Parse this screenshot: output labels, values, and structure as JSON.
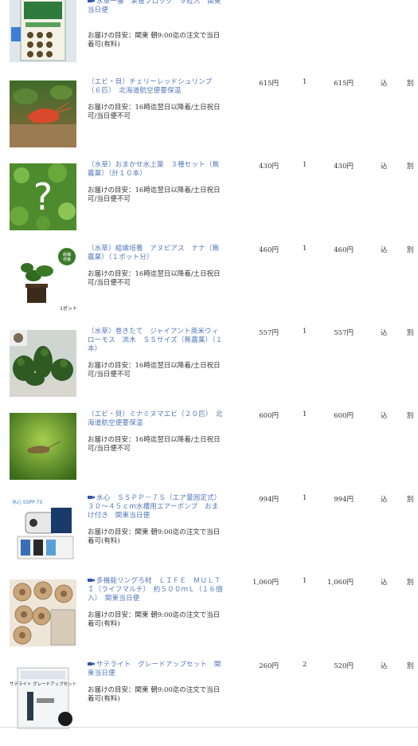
{
  "cart": {
    "items": [
      {
        "title": "水草一番　栄養ブロック　９粒入　関東当日便",
        "delivery": "お届けの目安：関東 朝9:00迄の注文で当日着可(有料)",
        "price": "",
        "qty": "",
        "subtotal": "",
        "tax": "",
        "shipping": "",
        "shop_icon": true,
        "image": "nutrition-block-package"
      },
      {
        "title": "（エビ・貝）チェリーレッドシュリンプ（６匹）　北海道航空便要保温",
        "delivery": "お届けの目安：16時迄翌日以降着/土日祝日可/当日便不可",
        "price": "615円",
        "qty": "1",
        "subtotal": "615円",
        "tax": "込",
        "shipping": "別",
        "shop_icon": false,
        "image": "cherry-shrimp"
      },
      {
        "title": "（水草）おまかせ水上葉　３種セット（無農薬）（計１０本）",
        "delivery": "お届けの目安：16時迄翌日以降着/土日祝日可/当日便不可",
        "price": "430円",
        "qty": "1",
        "subtotal": "430円",
        "tax": "込",
        "shipping": "別",
        "shop_icon": false,
        "image": "mystery-plants",
        "image_glyph": "?"
      },
      {
        "title": "（水草）組織培養　アヌビアス　ナナ（無農薬）（１ポット分）",
        "delivery": "お届けの目安：16時迄翌日以降着/土日祝日可/当日便不可",
        "price": "460円",
        "qty": "1",
        "subtotal": "460円",
        "tax": "込",
        "shipping": "別",
        "shop_icon": false,
        "image": "anubias-pot",
        "image_badge": "組織培養",
        "image_caption": "1ポット"
      },
      {
        "title": "（水草）巻きたて　ジャイアント南米ウィローモス　流木　ＳＳサイズ（無農薬）（１本）",
        "delivery": "お届けの目安：16時迄翌日以降着/土日祝日可/当日便不可",
        "price": "557円",
        "qty": "1",
        "subtotal": "557円",
        "tax": "込",
        "shipping": "別",
        "shop_icon": false,
        "image": "willow-moss-driftwood"
      },
      {
        "title": "（エビ・貝）ミナミヌマエビ（２０匹）　北海道航空便要保温",
        "delivery": "お届けの目安：16時迄翌日以降着/土日祝日可/当日便不可",
        "price": "600円",
        "qty": "1",
        "subtotal": "600円",
        "tax": "込",
        "shipping": "別",
        "shop_icon": false,
        "image": "minami-shrimp"
      },
      {
        "title": "水心　ＳＳＰＰ－７Ｓ（エア量固定式）　３０～４５ｃｍ水槽用エアーポンプ　おまけ付き　関東当日便",
        "delivery": "お届けの目安：関東 朝9:00迄の注文で当日着可(有料)",
        "price": "994円",
        "qty": "1",
        "subtotal": "994円",
        "tax": "込",
        "shipping": "別",
        "shop_icon": true,
        "image": "air-pump"
      },
      {
        "title": "多機能リングろ材　ＬＩＦＥ　ＭＵＬＴＩ（ライフマルチ）　約５００ｍＬ（１６個入）　関東当日便",
        "delivery": "お届けの目安：関東 朝9:00迄の注文で当日着可(有料)",
        "price": "1,060円",
        "qty": "1",
        "subtotal": "1,060円",
        "tax": "込",
        "shipping": "別",
        "shop_icon": true,
        "image": "ring-filter-media"
      },
      {
        "title": "サテライト　グレードアップセット　関東当日便",
        "delivery": "お届けの目安：関東 朝9:00迄の注文で当日着可(有料)",
        "price": "260円",
        "qty": "2",
        "subtotal": "520円",
        "tax": "込",
        "shipping": "別",
        "shop_icon": true,
        "image": "satellite-upgrade-set"
      }
    ]
  }
}
